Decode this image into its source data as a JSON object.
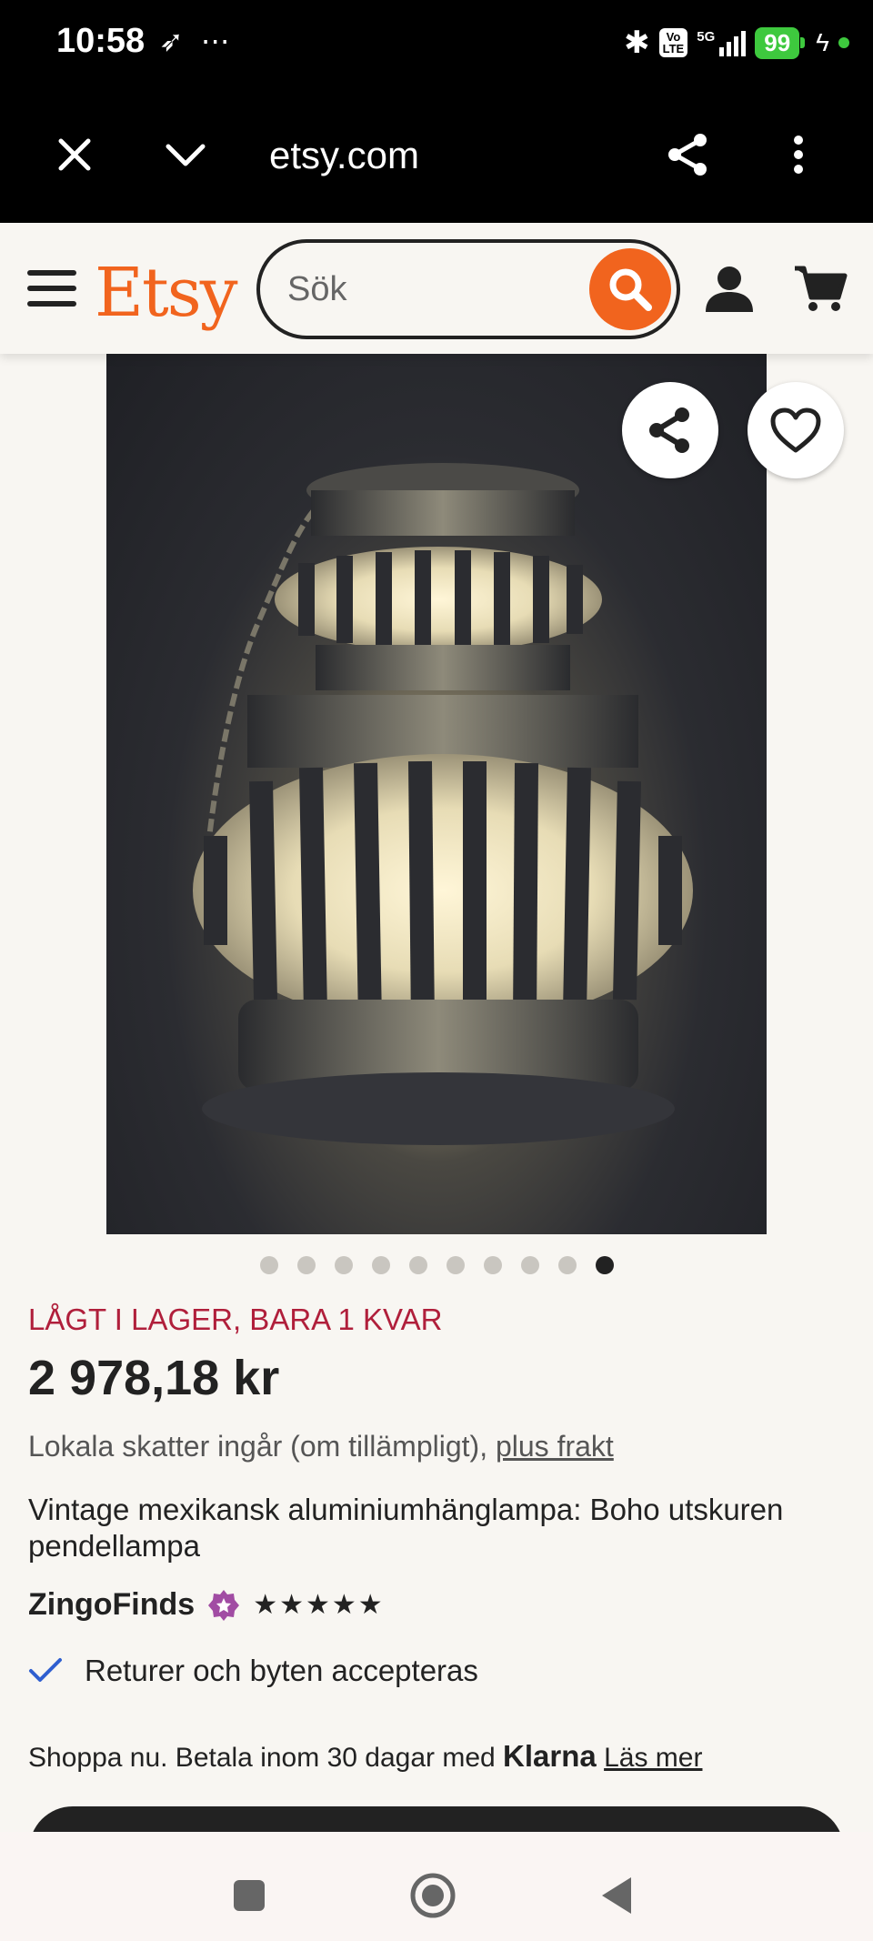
{
  "status_bar": {
    "time": "10:58",
    "extra_icons": "⋯",
    "network": "5G",
    "volte": "Vo\nLTE",
    "battery": "99"
  },
  "browser": {
    "url": "etsy.com"
  },
  "header": {
    "logo": "Etsy",
    "search_placeholder": "Sök"
  },
  "gallery": {
    "total_images": 10,
    "active_index": 9
  },
  "product": {
    "stock_notice": "LÅGT I LAGER, BARA 1 KVAR",
    "price": "2 978,18 kr",
    "tax_text": "Lokala skatter ingår (om tillämpligt), ",
    "tax_link": "plus frakt",
    "title": "Vintage mexikansk aluminiumhänglampa: Boho utskuren pendellampa",
    "shop_name": "ZingoFinds",
    "rating_stars": "★★★★★",
    "returns": "Returer och byten accepteras",
    "klarna_text": "Shoppa nu. Betala inom 30 dagar med ",
    "klarna_brand": "Klarna",
    "klarna_link": "Läs mer"
  },
  "colors": {
    "brand": "#f1641e",
    "stock_red": "#b01f3b",
    "star_seller": "#a14ca3",
    "check_blue": "#2f5fd0"
  }
}
